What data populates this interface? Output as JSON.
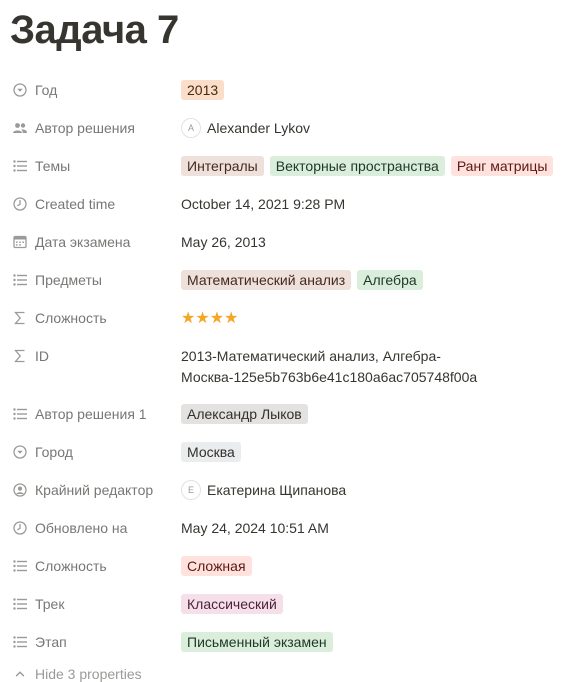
{
  "page": {
    "title": "Задача 7"
  },
  "properties": {
    "year": {
      "label": "Год",
      "icon": "select-icon",
      "value": "2013",
      "color": "orange"
    },
    "solution_author": {
      "label": "Автор решения",
      "icon": "people-icon",
      "avatar_initial": "A",
      "value": "Alexander Lykov"
    },
    "topics": {
      "label": "Темы",
      "icon": "multi-select-icon",
      "tags": [
        {
          "text": "Интегралы",
          "color": "brown"
        },
        {
          "text": "Векторные пространства",
          "color": "green"
        },
        {
          "text": "Ранг матрицы",
          "color": "red"
        }
      ]
    },
    "created_time": {
      "label": "Created time",
      "icon": "clock-icon",
      "value": "October 14, 2021 9:28 PM"
    },
    "exam_date": {
      "label": "Дата экзамена",
      "icon": "calendar-icon",
      "value": "May 26, 2013"
    },
    "subjects": {
      "label": "Предметы",
      "icon": "multi-select-icon",
      "tags": [
        {
          "text": "Математический анализ",
          "color": "brown"
        },
        {
          "text": "Алгебра",
          "color": "green"
        }
      ]
    },
    "difficulty_formula": {
      "label": "Сложность",
      "icon": "formula-icon",
      "value": "★★★★",
      "rating": 4
    },
    "id": {
      "label": "ID",
      "icon": "formula-icon",
      "line1": "2013-Математический анализ, Алгебра-",
      "line2": "Москва-125e5b763b6e41c180a6ac705748f00a"
    },
    "solution_author_1": {
      "label": "Автор решения 1",
      "icon": "multi-select-icon",
      "tags": [
        {
          "text": "Александр Лыков",
          "color": "gray"
        }
      ]
    },
    "city": {
      "label": "Город",
      "icon": "select-icon",
      "value": "Москва",
      "color": "lightgray"
    },
    "last_editor": {
      "label": "Крайний редактор",
      "icon": "person-icon",
      "avatar_initial": "E",
      "value": "Екатерина Щипанова"
    },
    "updated_at": {
      "label": "Обновлено на",
      "icon": "clock-icon",
      "value": "May 24, 2024 10:51 AM"
    },
    "difficulty": {
      "label": "Сложность",
      "icon": "multi-select-icon",
      "tags": [
        {
          "text": "Сложная",
          "color": "red"
        }
      ]
    },
    "track": {
      "label": "Трек",
      "icon": "multi-select-icon",
      "tags": [
        {
          "text": "Классический",
          "color": "pink"
        }
      ]
    },
    "stage": {
      "label": "Этап",
      "icon": "multi-select-icon",
      "tags": [
        {
          "text": "Письменный экзамен",
          "color": "green"
        }
      ]
    }
  },
  "footer": {
    "hide_label": "Hide 3 properties",
    "icon": "chevron-up-icon"
  }
}
